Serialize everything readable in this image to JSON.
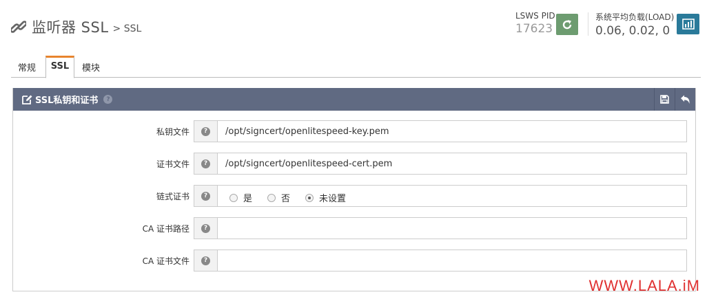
{
  "header": {
    "title": "监听器 SSL",
    "subtitle": "> SSL",
    "pid_label": "LSWS PID",
    "pid_value": "17623",
    "load_label": "系统平均负载(LOAD)",
    "load_value": "0.06, 0.02, 0",
    "icons": {
      "title": "link-icon",
      "reload": "reload-icon",
      "stats": "bar-chart-icon"
    },
    "colors": {
      "reload_bg": "#6d9c70",
      "stats_bg": "#2a7a9a"
    }
  },
  "tabs": [
    {
      "label": "常规",
      "active": false
    },
    {
      "label": "SSL",
      "active": true
    },
    {
      "label": "模块",
      "active": false
    }
  ],
  "panel": {
    "title": "SSL私钥和证书",
    "header_color": "#606a82",
    "icons": {
      "title": "edit-icon",
      "save": "save-icon",
      "back": "back-icon"
    },
    "rows": [
      {
        "label": "私钥文件",
        "value": "/opt/signcert/openlitespeed-key.pem"
      },
      {
        "label": "证书文件",
        "value": "/opt/signcert/openlitespeed-cert.pem"
      },
      {
        "label": "链式证书",
        "options": [
          "是",
          "否",
          "未设置"
        ],
        "selected": "未设置"
      },
      {
        "label": "CA 证书路径",
        "value": ""
      },
      {
        "label": "CA 证书文件",
        "value": ""
      }
    ]
  },
  "watermark": "WWW.LALA.iM"
}
